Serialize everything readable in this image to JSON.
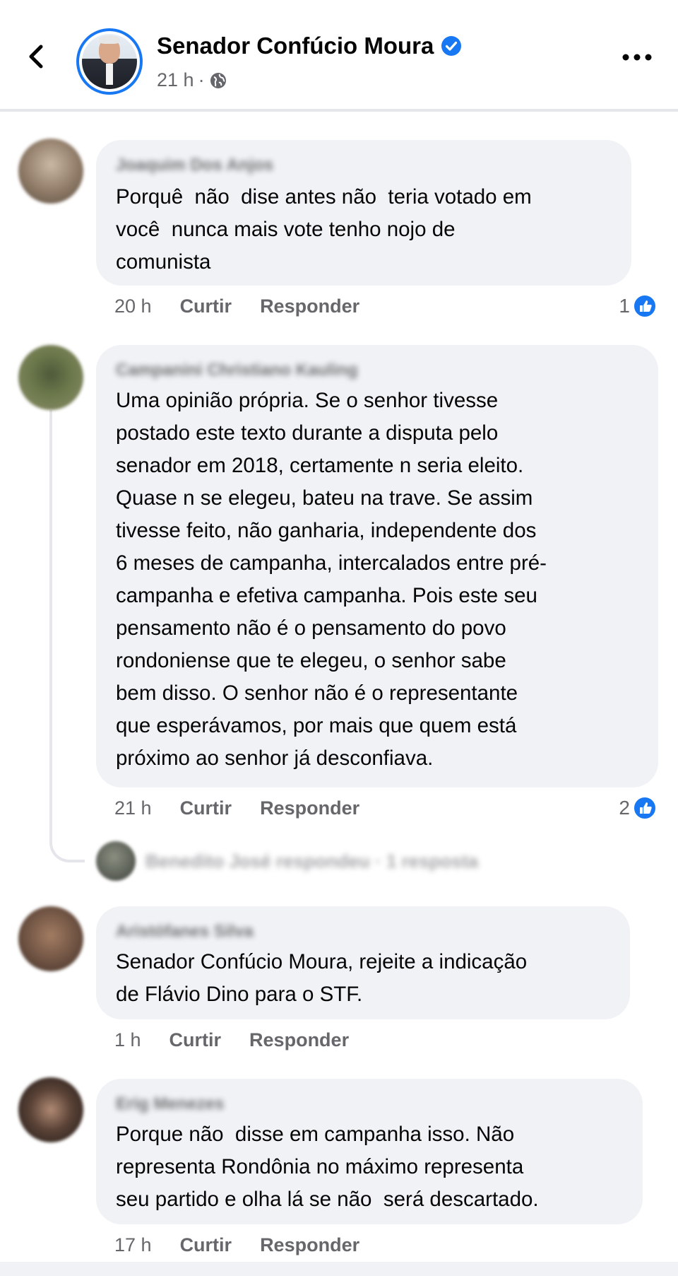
{
  "header": {
    "page_name": "Senador Confúcio Moura",
    "post_time": "21 h",
    "separator": "·"
  },
  "comments": [
    {
      "author": "Joaquim Dos Anjos",
      "text": "Porquê  não  dise antes não  teria votado em\nvocê  nunca mais vote tenho nojo de\ncomunista",
      "time": "20 h",
      "like_label": "Curtir",
      "reply_label": "Responder",
      "reaction_count": "1"
    },
    {
      "author": "Campanini Christiano Kauling",
      "text": "Uma opinião própria. Se o senhor tivesse\npostado este texto durante a disputa pelo\nsenador em 2018, certamente n seria eleito.\nQuase n se elegeu, bateu na trave. Se assim\ntivesse feito, não ganharia, independente dos\n6 meses de campanha, intercalados entre pré-\ncampanha e efetiva campanha. Pois este seu\npensamento não é o pensamento do povo\nrondoniense que te elegeu, o senhor sabe\nbem disso. O senhor não é o representante\nque esperávamos, por mais que quem está\npróximo ao senhor já desconfiava.",
      "time": "21 h",
      "like_label": "Curtir",
      "reply_label": "Responder",
      "reaction_count": "2",
      "replies_summary": "Benedito José respondeu · 1 resposta"
    },
    {
      "author": "Aristófanes Silva",
      "text": "Senador Confúcio Moura, rejeite a indicação\nde Flávio Dino para o STF.",
      "time": "1 h",
      "like_label": "Curtir",
      "reply_label": "Responder"
    },
    {
      "author": "Erig Menezes",
      "text": "Porque não  disse em campanha isso. Não\nrepresenta Rondônia no máximo representa\nseu partido e olha lá se não  será descartado.",
      "time": "17 h",
      "like_label": "Curtir",
      "reply_label": "Responder"
    }
  ],
  "colors": {
    "accent": "#1877f2",
    "bubble": "#f0f2f5",
    "secondary_text": "#65676b"
  },
  "icons": [
    "back-arrow-icon",
    "verified-badge-icon",
    "globe-icon",
    "more-options-icon",
    "like-reaction-icon"
  ]
}
